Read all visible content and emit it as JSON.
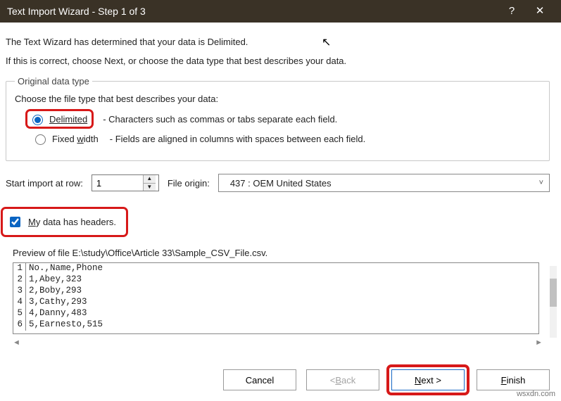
{
  "titlebar": {
    "title": "Text Import Wizard - Step 1 of 3",
    "help": "?",
    "close": "✕"
  },
  "intro": {
    "line1": "The Text Wizard has determined that your data is Delimited.",
    "line2": "If this is correct, choose Next, or choose the data type that best describes your data."
  },
  "group": {
    "legend": "Original data type",
    "choose": "Choose the file type that best describes your data:",
    "delimited_label": "Delimited",
    "delimited_desc": "- Characters such as commas or tabs separate each field.",
    "fixed_label": "Fixed width",
    "fixed_desc": "- Fields are aligned in columns with spaces between each field."
  },
  "start_row": {
    "label": "Start import at row:",
    "value": "1"
  },
  "origin": {
    "label": "File origin:",
    "value": "437 : OEM United States"
  },
  "headers": {
    "label": "My data has headers."
  },
  "preview": {
    "label": "Preview of file E:\\study\\Office\\Article 33\\Sample_CSV_File.csv.",
    "lines": [
      {
        "n": "1",
        "t": "No.,Name,Phone"
      },
      {
        "n": "2",
        "t": "1,Abey,323"
      },
      {
        "n": "3",
        "t": "2,Boby,293"
      },
      {
        "n": "4",
        "t": "3,Cathy,293"
      },
      {
        "n": "5",
        "t": "4,Danny,483"
      },
      {
        "n": "6",
        "t": "5,Earnesto,515"
      }
    ]
  },
  "buttons": {
    "cancel": "Cancel",
    "back": "< Back",
    "next": "Next >",
    "finish": "Finish"
  },
  "watermark": "wsxdn.com"
}
